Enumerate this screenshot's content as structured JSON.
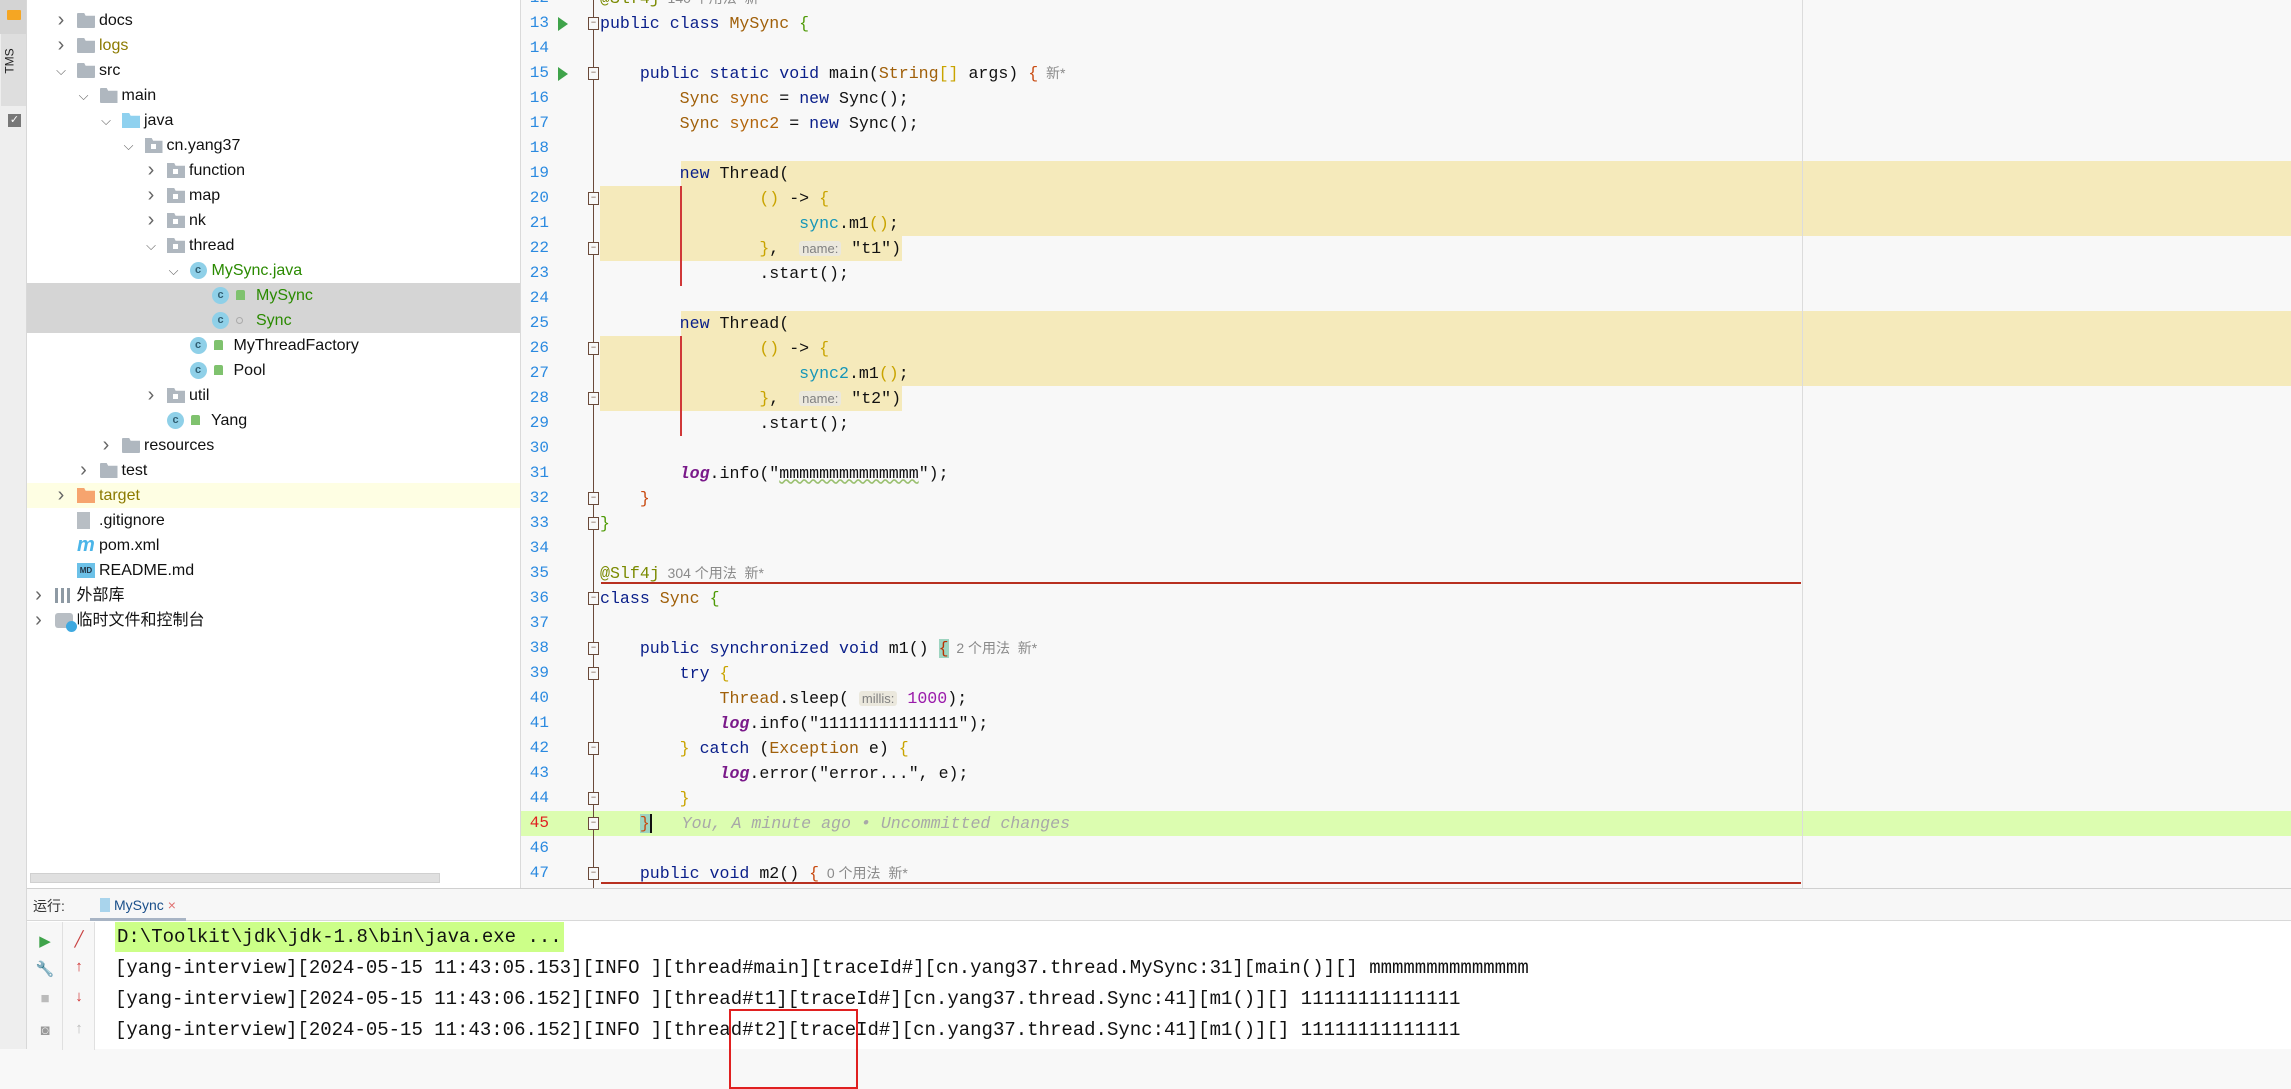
{
  "toolstrip": {
    "tms_label": "TMS"
  },
  "tree": {
    "items": [
      {
        "label": "docs",
        "level": 0,
        "chevron": "right",
        "icon": "folder"
      },
      {
        "label": "logs",
        "level": 0,
        "chevron": "right",
        "icon": "folder",
        "color": "#8c7a00"
      },
      {
        "label": "src",
        "level": 0,
        "chevron": "down",
        "icon": "folder"
      },
      {
        "label": "main",
        "level": 1,
        "chevron": "down",
        "icon": "folder"
      },
      {
        "label": "java",
        "level": 2,
        "chevron": "down",
        "icon": "folder-src"
      },
      {
        "label": "cn.yang37",
        "level": 3,
        "chevron": "down",
        "icon": "package"
      },
      {
        "label": "function",
        "level": 4,
        "chevron": "right",
        "icon": "package"
      },
      {
        "label": "map",
        "level": 4,
        "chevron": "right",
        "icon": "package"
      },
      {
        "label": "nk",
        "level": 4,
        "chevron": "right",
        "icon": "package"
      },
      {
        "label": "thread",
        "level": 4,
        "chevron": "down",
        "icon": "package"
      },
      {
        "label": "MySync.java",
        "level": 5,
        "chevron": "down",
        "icon": "class",
        "color": "#2a8a00"
      },
      {
        "label": "MySync",
        "level": 6,
        "icon": "class",
        "sub": "lock",
        "color": "#2a8a00",
        "selected": true
      },
      {
        "label": "Sync",
        "level": 6,
        "icon": "class",
        "sub": "dot",
        "color": "#2a8a00",
        "selected": true
      },
      {
        "label": "MyThreadFactory",
        "level": 5,
        "icon": "class",
        "sub": "lock"
      },
      {
        "label": "Pool",
        "level": 5,
        "icon": "class",
        "sub": "lock"
      },
      {
        "label": "util",
        "level": 4,
        "chevron": "right",
        "icon": "package"
      },
      {
        "label": "Yang",
        "level": 4,
        "icon": "class",
        "sub": "lock"
      },
      {
        "label": "resources",
        "level": 2,
        "chevron": "right",
        "icon": "folder"
      },
      {
        "label": "test",
        "level": 1,
        "chevron": "right",
        "icon": "folder"
      },
      {
        "label": "target",
        "level": 0,
        "chevron": "right",
        "icon": "folder-orange",
        "color": "#8c7a00",
        "highlight": true
      },
      {
        "label": ".gitignore",
        "level": 0,
        "icon": "file"
      },
      {
        "label": "pom.xml",
        "level": 0,
        "icon": "maven"
      },
      {
        "label": "README.md",
        "level": 0,
        "icon": "md"
      },
      {
        "label": "外部库",
        "level": -1,
        "chevron": "right",
        "icon": "libs"
      },
      {
        "label": "临时文件和控制台",
        "level": -1,
        "chevron": "right",
        "icon": "scratch"
      }
    ]
  },
  "editor": {
    "current_line": 45,
    "lines": [
      {
        "n": 12,
        "tokens": [
          [
            "@Slf4j",
            "a"
          ],
          [
            "  140 个用法  新",
            "g"
          ]
        ]
      },
      {
        "n": 13,
        "run": true,
        "fold": "open",
        "tokens": [
          [
            "public class ",
            "k"
          ],
          [
            "MySync",
            "c"
          ],
          [
            " ",
            "p"
          ],
          [
            "{",
            "bg"
          ]
        ]
      },
      {
        "n": 14,
        "tokens": []
      },
      {
        "n": 15,
        "run": true,
        "fold": "open",
        "tokens": [
          [
            "    public static void ",
            "k"
          ],
          [
            "main(",
            "p"
          ],
          [
            "String",
            "c"
          ],
          [
            "[]",
            "by"
          ],
          [
            " args) ",
            "p"
          ],
          [
            "{",
            "bo"
          ],
          [
            "  新*",
            "g"
          ]
        ]
      },
      {
        "n": 16,
        "tokens": [
          [
            "        ",
            "p"
          ],
          [
            "Sync",
            "c"
          ],
          [
            " sync",
            "v"
          ],
          [
            " = ",
            "p"
          ],
          [
            "new",
            "k"
          ],
          [
            " Sync();",
            "p"
          ]
        ]
      },
      {
        "n": 17,
        "tokens": [
          [
            "        ",
            "p"
          ],
          [
            "Sync",
            "c"
          ],
          [
            " sync2",
            "v"
          ],
          [
            " = ",
            "p"
          ],
          [
            "new",
            "k"
          ],
          [
            " Sync();",
            "p"
          ]
        ]
      },
      {
        "n": 18,
        "tokens": []
      },
      {
        "n": 19,
        "tokens": [
          [
            "        ",
            "p"
          ],
          [
            "new",
            "k"
          ],
          [
            " Thread(",
            "p"
          ]
        ]
      },
      {
        "n": 20,
        "fold": "open",
        "tokens": [
          [
            "                ",
            "p"
          ],
          [
            "()",
            "by"
          ],
          [
            " -> ",
            "p"
          ],
          [
            "{",
            "by"
          ]
        ]
      },
      {
        "n": 21,
        "tokens": [
          [
            "                    ",
            "p"
          ],
          [
            "sync",
            "f"
          ],
          [
            ".m1",
            "p"
          ],
          [
            "()",
            "by"
          ],
          [
            ";",
            "p"
          ]
        ]
      },
      {
        "n": 22,
        "fold": "close",
        "tokens": [
          [
            "                ",
            "p"
          ],
          [
            "}",
            "by"
          ],
          [
            ",  ",
            "p"
          ],
          [
            "name:",
            "h"
          ],
          [
            " \"t1\")",
            "s"
          ]
        ]
      },
      {
        "n": 23,
        "tokens": [
          [
            "                .start();",
            "p"
          ]
        ]
      },
      {
        "n": 24,
        "tokens": []
      },
      {
        "n": 25,
        "tokens": [
          [
            "        ",
            "p"
          ],
          [
            "new",
            "k"
          ],
          [
            " Thread(",
            "p"
          ]
        ]
      },
      {
        "n": 26,
        "fold": "open",
        "tokens": [
          [
            "                ",
            "p"
          ],
          [
            "()",
            "by"
          ],
          [
            " -> ",
            "p"
          ],
          [
            "{",
            "by"
          ]
        ]
      },
      {
        "n": 27,
        "tokens": [
          [
            "                    ",
            "p"
          ],
          [
            "sync2",
            "f"
          ],
          [
            ".m1",
            "p"
          ],
          [
            "()",
            "by"
          ],
          [
            ";",
            "p"
          ]
        ]
      },
      {
        "n": 28,
        "fold": "close",
        "tokens": [
          [
            "                ",
            "p"
          ],
          [
            "}",
            "by"
          ],
          [
            ",  ",
            "p"
          ],
          [
            "name:",
            "h"
          ],
          [
            " \"t2\")",
            "s"
          ]
        ]
      },
      {
        "n": 29,
        "tokens": [
          [
            "                .start();",
            "p"
          ]
        ]
      },
      {
        "n": 30,
        "tokens": []
      },
      {
        "n": 31,
        "tokens": [
          [
            "        ",
            "p"
          ],
          [
            "log",
            "l"
          ],
          [
            ".info(\"",
            "p"
          ],
          [
            "mmmmmmmmmmmmmm",
            "sw"
          ],
          [
            "\");",
            "p"
          ]
        ]
      },
      {
        "n": 32,
        "fold": "close",
        "tokens": [
          [
            "    ",
            "p"
          ],
          [
            "}",
            "bo"
          ]
        ]
      },
      {
        "n": 33,
        "fold": "close",
        "tokens": [
          [
            "}",
            "bg"
          ]
        ]
      },
      {
        "n": 34,
        "tokens": []
      },
      {
        "n": 35,
        "tokens": [
          [
            "@Slf4j",
            "a"
          ],
          [
            "  304 个用法  新*",
            "g"
          ]
        ]
      },
      {
        "n": 36,
        "fold": "open",
        "tokens": [
          [
            "class ",
            "k"
          ],
          [
            "Sync",
            "c"
          ],
          [
            " ",
            "p"
          ],
          [
            "{",
            "bg"
          ]
        ]
      },
      {
        "n": 37,
        "tokens": []
      },
      {
        "n": 38,
        "fold": "open",
        "tokens": [
          [
            "    public synchronized void ",
            "k"
          ],
          [
            "m1() ",
            "p"
          ],
          [
            "{",
            "bt"
          ],
          [
            "  2 个用法  新*",
            "g"
          ]
        ]
      },
      {
        "n": 39,
        "fold": "open",
        "tokens": [
          [
            "        try ",
            "k"
          ],
          [
            "{",
            "by"
          ]
        ]
      },
      {
        "n": 40,
        "tokens": [
          [
            "            ",
            "p"
          ],
          [
            "Thread",
            "c"
          ],
          [
            ".sleep( ",
            "p"
          ],
          [
            "millis:",
            "h"
          ],
          [
            " ",
            "p"
          ],
          [
            "1000",
            "n"
          ],
          [
            ");",
            "p"
          ]
        ]
      },
      {
        "n": 41,
        "tokens": [
          [
            "            ",
            "p"
          ],
          [
            "log",
            "l"
          ],
          [
            ".info(\"11111111111111\");",
            "p"
          ]
        ]
      },
      {
        "n": 42,
        "fold": "open",
        "tokens": [
          [
            "        ",
            "p"
          ],
          [
            "}",
            "by"
          ],
          [
            " catch ",
            "k"
          ],
          [
            "(",
            "p"
          ],
          [
            "Exception",
            "c"
          ],
          [
            " e) ",
            "p"
          ],
          [
            "{",
            "by"
          ]
        ]
      },
      {
        "n": 43,
        "tokens": [
          [
            "            ",
            "p"
          ],
          [
            "log",
            "l"
          ],
          [
            ".error(\"error...\", e);",
            "p"
          ]
        ]
      },
      {
        "n": 44,
        "fold": "close",
        "tokens": [
          [
            "        ",
            "p"
          ],
          [
            "}",
            "by"
          ]
        ]
      },
      {
        "n": 45,
        "fold": "close",
        "tokens": [
          [
            "    ",
            "p"
          ],
          [
            "}",
            "cur"
          ],
          [
            "   You, A minute ago • Uncommitted changes",
            "i"
          ]
        ]
      },
      {
        "n": 46,
        "tokens": []
      },
      {
        "n": 47,
        "fold": "open",
        "tokens": [
          [
            "    public void ",
            "k"
          ],
          [
            "m2() ",
            "p"
          ],
          [
            "{",
            "bo"
          ],
          [
            "  0 个用法  新*",
            "g"
          ]
        ]
      }
    ]
  },
  "run_panel": {
    "label": "运行:",
    "tab_label": "MySync",
    "close_glyph": "×",
    "console_lines": [
      "D:\\Toolkit\\jdk\\jdk-1.8\\bin\\java.exe ...",
      "[yang-interview][2024-05-15 11:43:05.153][INFO ][thread#main][traceId#][cn.yang37.thread.MySync:31][main()][] mmmmmmmmmmmmmm",
      "[yang-interview][2024-05-15 11:43:06.152][INFO ][thread#t1][traceId#][cn.yang37.thread.Sync:41][m1()][] 11111111111111",
      "[yang-interview][2024-05-15 11:43:06.152][INFO ][thread#t2][traceId#][cn.yang37.thread.Sync:41][m1()][] 11111111111111"
    ]
  },
  "colors": {
    "accent_highlight": "#f5eabb",
    "changed_line": "#dcfdb0",
    "annotation_box": "#e02020",
    "run_green": "#3fa34a"
  }
}
